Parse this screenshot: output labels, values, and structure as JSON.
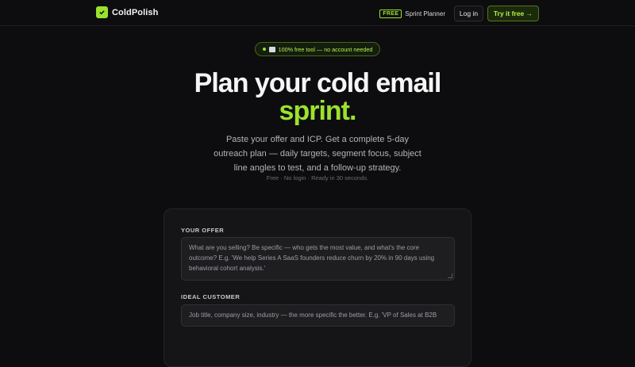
{
  "nav": {
    "brand": "ColdPolish",
    "free_badge": "FREE",
    "sprint_link": "Sprint Planner",
    "login": "Log in",
    "cta": "Try it free →"
  },
  "hero": {
    "badge": "100% free tool — no account needed",
    "title_line1": "Plan your cold email",
    "title_line2": "sprint.",
    "subtitle": "Paste your offer and ICP. Get a complete 5-day outreach plan — daily targets, segment focus, subject line angles to test, and a follow-up strategy.",
    "meta": "Free · No login · Ready in 30 seconds."
  },
  "form": {
    "offer_label": "YOUR OFFER",
    "offer_placeholder": "What are you selling? Be specific — who gets the most value, and what's the core outcome? E.g. 'We help Series A SaaS founders reduce churn by 20% in 90 days using behavioral cohort analysis.'",
    "customer_label": "IDEAL CUSTOMER",
    "customer_placeholder": "Job title, company size, industry — the more specific the better. E.g. 'VP of Sales at B2B"
  },
  "colors": {
    "accent": "#9be22d",
    "background": "#0d0d0f",
    "card": "#151517"
  }
}
